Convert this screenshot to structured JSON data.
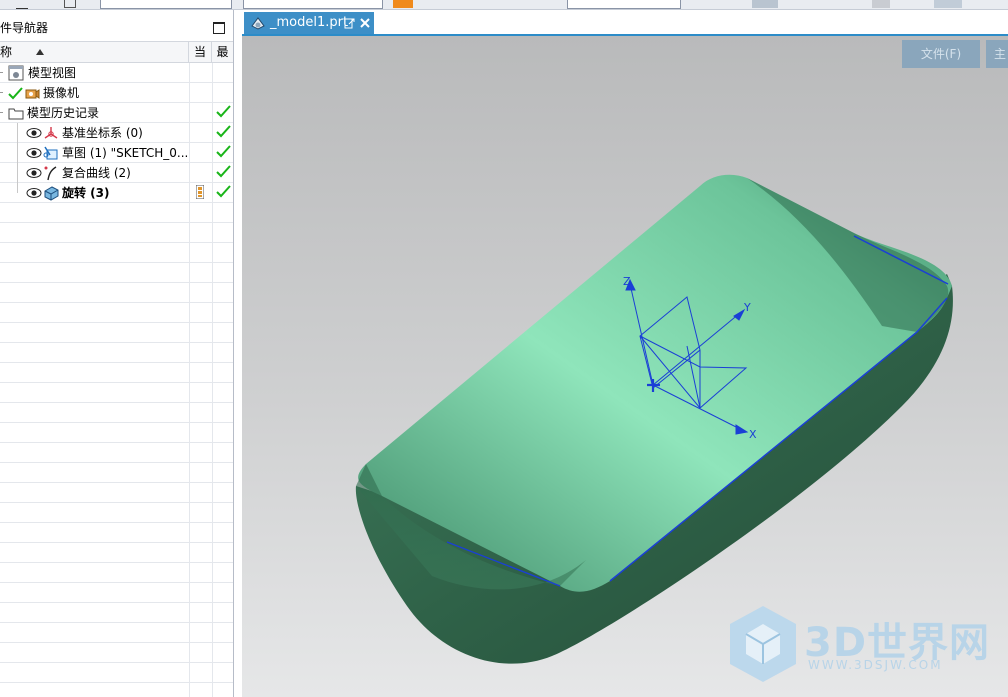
{
  "navigator": {
    "title": "部件导航器",
    "columns": {
      "name": "名称",
      "current": "当",
      "latest": "最"
    },
    "items": [
      {
        "label": "模型视图",
        "icon": "model-view-icon",
        "bold": false
      },
      {
        "label": "摄像机",
        "icon": "camera-icon",
        "bold": false
      },
      {
        "label": "模型历史记录",
        "icon": "folder-icon",
        "bold": false
      },
      {
        "label": "基准坐标系 (0)",
        "icon": "datum-csys-icon",
        "bold": false
      },
      {
        "label": "草图 (1) \"SKETCH_0...",
        "icon": "sketch-icon",
        "bold": false
      },
      {
        "label": "复合曲线 (2)",
        "icon": "composite-curve-icon",
        "bold": false
      },
      {
        "label": "旋转 (3)",
        "icon": "revolve-icon",
        "bold": true
      }
    ]
  },
  "tab": {
    "title": "_model1.prt"
  },
  "viewport": {
    "file_button": "文件(F)",
    "main_button": "主",
    "axes": {
      "x": "X",
      "y": "Y",
      "z": "Z"
    }
  },
  "watermark": {
    "brand": "3D世界网",
    "url": "WWW.3DSJW.COM"
  },
  "colors": {
    "part_green": "#4f9a78",
    "tab_blue": "#3d8fc7",
    "check_green": "#19b519",
    "axis_blue": "#1a3fd6"
  }
}
